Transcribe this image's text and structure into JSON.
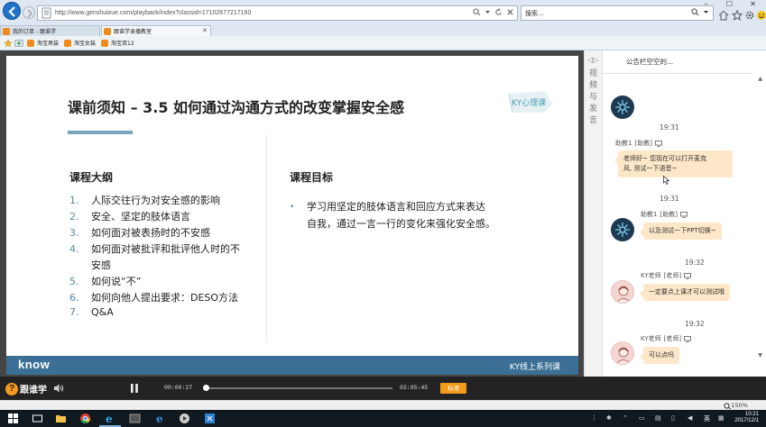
{
  "browser": {
    "url": "http://www.genshuixue.com/playback/index?classid=17102677217160",
    "search_placeholder": "搜索...",
    "tabs": [
      {
        "label": "我的订单 - 跟谁学",
        "active": false
      },
      {
        "label": "跟谁学录播教室",
        "active": true
      }
    ],
    "favorites": [
      "淘宝男装",
      "淘宝女装",
      "淘宝双12"
    ],
    "window_controls": {
      "minimize": "–",
      "maximize": "☐",
      "close": "✕"
    }
  },
  "slide": {
    "title": "课前须知 – 3.5 如何通过沟通方式的改变掌握安全感",
    "logo_text": "KY心理课",
    "outline_heading": "课程大纲",
    "outline": [
      {
        "num": "1.",
        "text": "人际交往行为对安全感的影响"
      },
      {
        "num": "2.",
        "text": "安全、坚定的肢体语言"
      },
      {
        "num": "3.",
        "text": "如何面对被表扬时的不安感"
      },
      {
        "num": "4.",
        "text": "如何面对被批评和批评他人时的不"
      },
      {
        "num": "",
        "text": "安感"
      },
      {
        "num": "5.",
        "text": "如何说“不”"
      },
      {
        "num": "6.",
        "text": "如何向他人提出要求：DESO方法"
      },
      {
        "num": "7.",
        "text": "Q&A"
      }
    ],
    "goal_heading": "课程目标",
    "goal_bullet": "•",
    "goal_lines": [
      "学习用坚定的肢体语言和回应方式来表达",
      "自我，通过一言一行的变化来强化安全感。"
    ],
    "footer_brand": "know",
    "footer_series": "KY线上系列课"
  },
  "side_tab": {
    "toggle": "◁▷",
    "label": "视频与发言"
  },
  "chat": {
    "notice": "公告栏空空的...",
    "messages": [
      {
        "time": "19:31",
        "user": "助教1",
        "role": "[助教]",
        "lines": [
          "老师好~ 您现在可以打开麦克",
          "风, 测试一下语音~"
        ],
        "avatar": "assistant"
      },
      {
        "time": "19:31",
        "user": "助教1",
        "role": "[助教]",
        "lines": [
          "以及测试一下PPT切换~"
        ],
        "avatar": "assistant"
      },
      {
        "time": "19:32",
        "user": "KY老师",
        "role": "[老师]",
        "lines": [
          "一定要点上课才可以测试哦"
        ],
        "avatar": "teacher"
      },
      {
        "time": "19:32",
        "user": "KY老师",
        "role": "[老师]",
        "lines": [
          "可以点吗"
        ],
        "avatar": "teacher"
      }
    ]
  },
  "player": {
    "brand": "跟谁学",
    "brand_mark": "?",
    "current_time": "00:00:27",
    "duration": "02:05:45",
    "progress_fraction": 0.0036,
    "quality_label": "标清"
  },
  "status": {
    "zoom": "150%"
  },
  "taskbar": {
    "ime": "英",
    "time": "10:21",
    "date": "2017/12/1"
  },
  "colors": {
    "accent_orange": "#f39a1b",
    "slide_blue": "#3b6f95",
    "bubble": "#fde7c8"
  }
}
